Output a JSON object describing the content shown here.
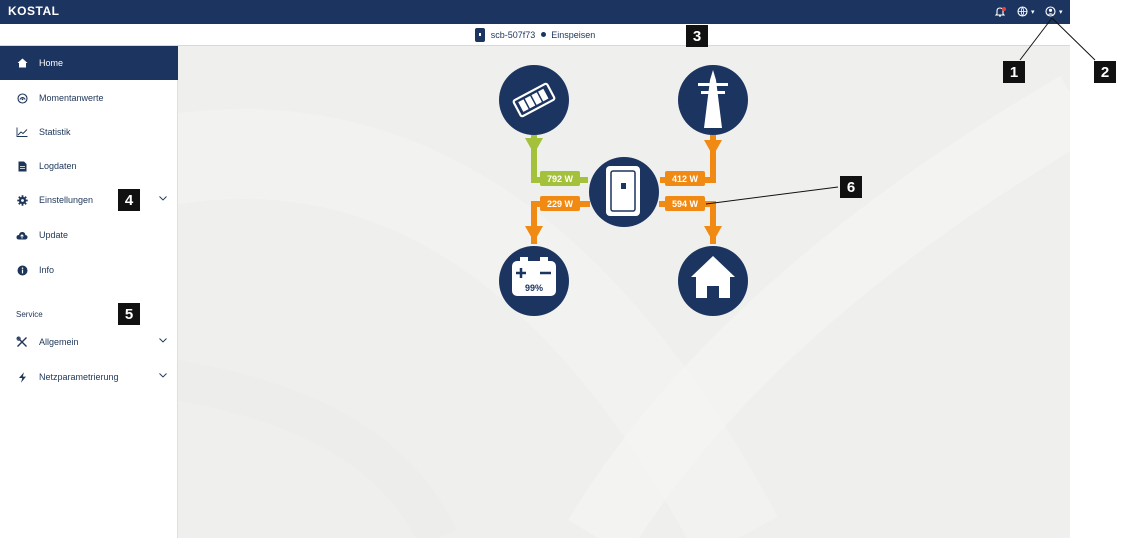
{
  "app": {
    "logo": "KOSTAL"
  },
  "device": {
    "name": "scb-507f73",
    "status": "Einspeisen"
  },
  "sidebar": {
    "items": [
      {
        "label": "Home",
        "icon": "home-icon",
        "active": true
      },
      {
        "label": "Momentanwerte",
        "icon": "gauge-icon"
      },
      {
        "label": "Statistik",
        "icon": "line-chart-icon"
      },
      {
        "label": "Logdaten",
        "icon": "file-icon"
      },
      {
        "label": "Einstellungen",
        "icon": "gear-icon",
        "expandable": true
      },
      {
        "label": "Update",
        "icon": "cloud-upload-icon"
      },
      {
        "label": "Info",
        "icon": "info-icon"
      }
    ],
    "service_title": "Service",
    "service_items": [
      {
        "label": "Allgemein",
        "icon": "tools-icon",
        "expandable": true
      },
      {
        "label": "Netzparametrierung",
        "icon": "bolt-icon",
        "expandable": true
      }
    ]
  },
  "energy_flow": {
    "pv_to_inverter": "792 W",
    "grid_to_inverter": "412 W",
    "inverter_to_battery": "229 W",
    "inverter_to_home": "594 W",
    "battery_soc": "99%"
  },
  "callouts": {
    "c1": "1",
    "c2": "2",
    "c3": "3",
    "c4": "4",
    "c5": "5",
    "c6": "6"
  },
  "colors": {
    "navy": "#1c3460",
    "green": "#a3c13a",
    "orange": "#f08a13",
    "background": "#efefed"
  }
}
